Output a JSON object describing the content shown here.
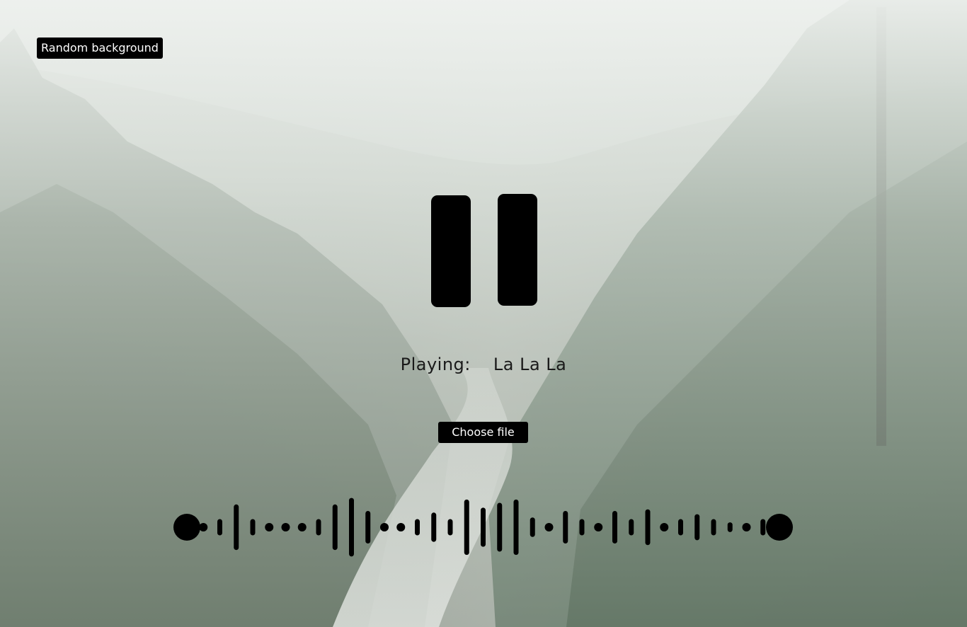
{
  "random_background_label": "Random background",
  "player": {
    "status_label": "Playing:",
    "track_title": "La La La",
    "choose_file_label": "Choose file"
  },
  "visualizer": {
    "levels": [
      1,
      0.05,
      0.25,
      0.7,
      0.25,
      0.05,
      0.05,
      0.05,
      0.25,
      0.7,
      0.9,
      0.5,
      0.05,
      0.05,
      0.25,
      0.45,
      0.25,
      0.85,
      0.6,
      0.75,
      0.85,
      0.3,
      0.05,
      0.5,
      0.25,
      0.05,
      0.5,
      0.25,
      0.55,
      0.05,
      0.25,
      0.4,
      0.25,
      0.15,
      0.05,
      0.25,
      1
    ]
  },
  "colors": {
    "ink": "#000000",
    "button_text": "#ffffff"
  }
}
